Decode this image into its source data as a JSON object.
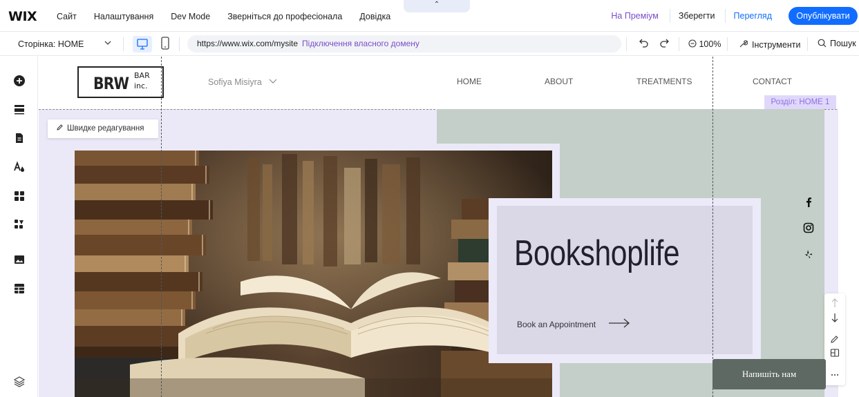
{
  "topbar": {
    "logo": "WIX",
    "menu": [
      "Сайт",
      "Налаштування",
      "Dev Mode",
      "Зверніться до професіонала",
      "Довідка"
    ],
    "premium": "На Преміум",
    "save": "Зберегти",
    "preview": "Перегляд",
    "publish": "Опублікувати",
    "pull_tab": "⌃"
  },
  "toolbar": {
    "page_label": "Сторінка: HOME",
    "url": "https://www.wix.com/mysite",
    "connect_domain": "Підключення власного домену",
    "zoom": "100%",
    "tools": "Інструменти",
    "search": "Пошук"
  },
  "site": {
    "brand": {
      "brw": "BRW",
      "bar": "BAR",
      "inc": "inc."
    },
    "user_name": "Sofiya Misiyra",
    "nav": [
      "HOME",
      "ABOUT",
      "TREATMENTS",
      "CONTACT"
    ],
    "section_label": "Розділ: HOME 1",
    "quick_edit": "Швидке редагування",
    "headline": "Bookshoplife",
    "cta": "Book an Appointment",
    "chat": "Напишіть нам"
  },
  "colors": {
    "accent": "#116dff",
    "premium": "#7a4cc8",
    "panel_green": "#c3cfc8",
    "card": "#dad7e7",
    "canvas_bg": "#ebe9f8",
    "chat_bg": "#5f6963"
  },
  "icons": {
    "left_rail": [
      "add-icon",
      "sections-icon",
      "pages-icon",
      "design-icon",
      "apps-icon",
      "business-icon",
      "media-icon",
      "cms-icon",
      "layers-icon"
    ],
    "social": [
      "facebook-icon",
      "instagram-icon",
      "yelp-icon"
    ]
  }
}
